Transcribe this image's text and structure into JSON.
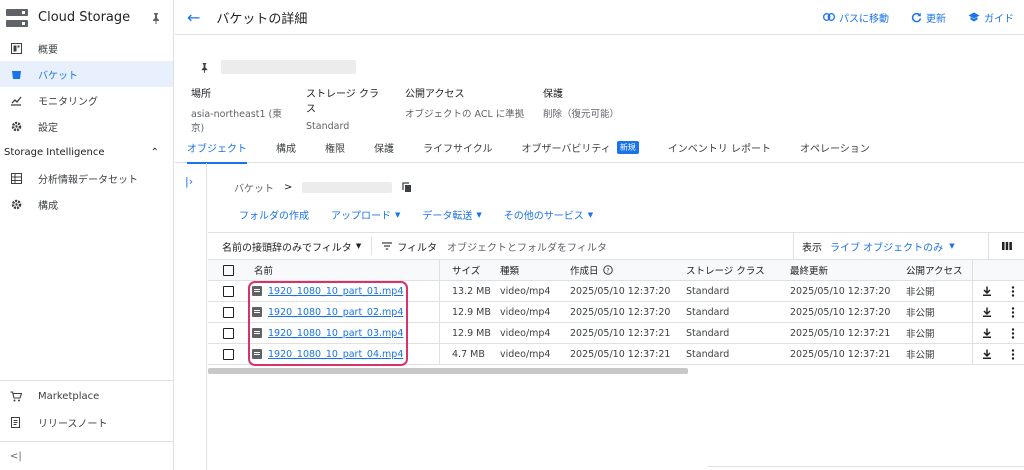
{
  "sidebar": {
    "title": "Cloud Storage",
    "items": [
      {
        "label": "概要",
        "icon": "dashboard-icon",
        "active": false
      },
      {
        "label": "バケット",
        "icon": "bucket-icon",
        "active": true
      },
      {
        "label": "モニタリング",
        "icon": "monitoring-icon",
        "active": false
      },
      {
        "label": "設定",
        "icon": "gear-icon",
        "active": false
      }
    ],
    "section_title": "Storage Intelligence",
    "section_items": [
      {
        "label": "分析情報データセット",
        "icon": "dataset-icon"
      },
      {
        "label": "構成",
        "icon": "gear-icon"
      }
    ],
    "bottom_items": [
      {
        "label": "Marketplace",
        "icon": "cart-icon"
      },
      {
        "label": "リリースノート",
        "icon": "notes-icon"
      }
    ],
    "collapse_label": "<|"
  },
  "header": {
    "title": "バケットの詳細",
    "actions": [
      {
        "label": "パスに移動",
        "icon": "link-icon"
      },
      {
        "label": "更新",
        "icon": "refresh-icon"
      },
      {
        "label": "ガイド",
        "icon": "school-icon"
      }
    ]
  },
  "bucket": {
    "props": [
      {
        "key": "場所",
        "value": "asia-northeast1 (東京)"
      },
      {
        "key": "ストレージ クラス",
        "value": "Standard"
      },
      {
        "key": "公開アクセス",
        "value": "オブジェクトの ACL に準拠"
      },
      {
        "key": "保護",
        "value": "削除（復元可能）"
      }
    ]
  },
  "tabs": [
    {
      "label": "オブジェクト",
      "active": true
    },
    {
      "label": "構成"
    },
    {
      "label": "権限"
    },
    {
      "label": "保護"
    },
    {
      "label": "ライフサイクル"
    },
    {
      "label": "オブザーバビリティ",
      "badge": "新規"
    },
    {
      "label": "インベントリ レポート"
    },
    {
      "label": "オペレーション"
    }
  ],
  "breadcrumb": {
    "root": "バケット",
    "separator": ">"
  },
  "actions": [
    {
      "label": "フォルダの作成",
      "dropdown": false
    },
    {
      "label": "アップロード",
      "dropdown": true
    },
    {
      "label": "データ転送",
      "dropdown": true
    },
    {
      "label": "その他のサービス",
      "dropdown": true
    }
  ],
  "filterbar": {
    "prefix_label": "名前の接頭辞のみでフィルタ",
    "filter_label": "フィルタ",
    "placeholder": "オブジェクトとフォルダをフィルタ",
    "view_label": "表示",
    "view_value": "ライブ オブジェクトのみ"
  },
  "table": {
    "columns": [
      "名前",
      "サイズ",
      "種類",
      "作成日",
      "ストレージ クラス",
      "最終更新",
      "公開アクセス"
    ],
    "rows": [
      {
        "name": "1920_1080_10_part_01.mp4",
        "size": "13.2 MB",
        "type": "video/mp4",
        "created": "2025/05/10 12:37:20",
        "class": "Standard",
        "modified": "2025/05/10 12:37:20",
        "public": "非公開"
      },
      {
        "name": "1920_1080_10_part_02.mp4",
        "size": "12.9 MB",
        "type": "video/mp4",
        "created": "2025/05/10 12:37:20",
        "class": "Standard",
        "modified": "2025/05/10 12:37:20",
        "public": "非公開"
      },
      {
        "name": "1920_1080_10_part_03.mp4",
        "size": "12.9 MB",
        "type": "video/mp4",
        "created": "2025/05/10 12:37:21",
        "class": "Standard",
        "modified": "2025/05/10 12:37:21",
        "public": "非公開"
      },
      {
        "name": "1920_1080_10_part_04.mp4",
        "size": "4.7 MB",
        "type": "video/mp4",
        "created": "2025/05/10 12:37:21",
        "class": "Standard",
        "modified": "2025/05/10 12:37:21",
        "public": "非公開"
      }
    ]
  },
  "colors": {
    "accent": "#1a73e8",
    "highlight": "#d6336c",
    "active_bg": "#e8f0fe"
  }
}
